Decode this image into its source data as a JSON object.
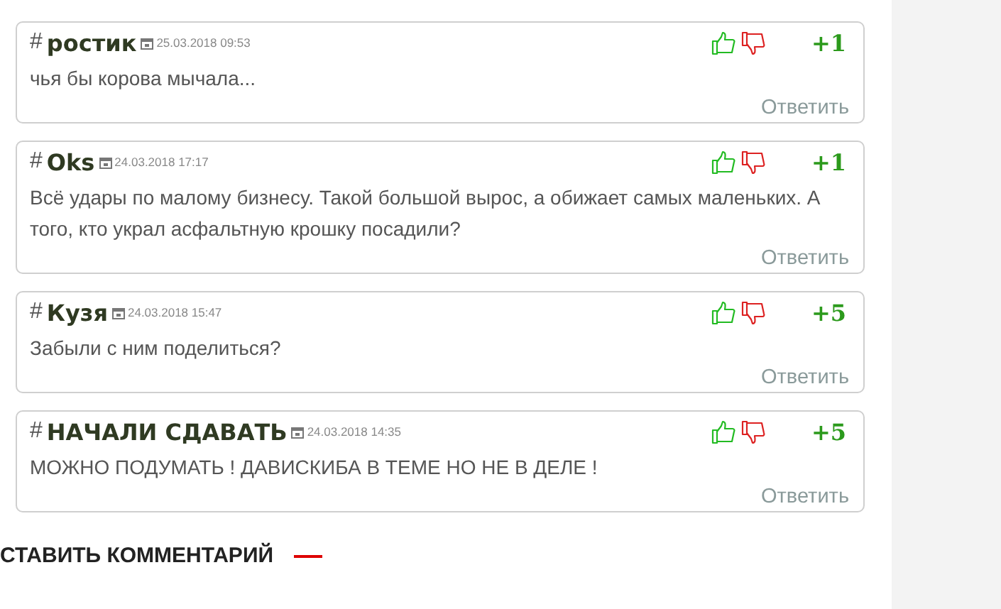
{
  "comments": [
    {
      "author": "ростик",
      "date": "25.03.2018 09:53",
      "score": "+1",
      "text": "чья бы корова мычала...",
      "reply": "Ответить"
    },
    {
      "author": "Oks",
      "date": "24.03.2018 17:17",
      "score": "+1",
      "text": "Всё удары по малому бизнесу. Такой большой вырос, а обижает самых маленьких. А того, кто украл асфальтную крошку посадили?",
      "reply": "Ответить"
    },
    {
      "author": "Кузя",
      "date": "24.03.2018 15:47",
      "score": "+5",
      "text": "Забыли с ним поделиться?",
      "reply": "Ответить"
    },
    {
      "author": "НАЧАЛИ СДАВАТЬ",
      "date": "24.03.2018 14:35",
      "score": "+5",
      "text": "МОЖНО ПОДУМАТЬ ! ДАВИСКИБА В ТЕМЕ НО НЕ В ДЕЛЕ !",
      "reply": "Ответить"
    }
  ],
  "hash": "#",
  "section_title": "СТАВИТЬ КОММЕНТАРИЙ"
}
